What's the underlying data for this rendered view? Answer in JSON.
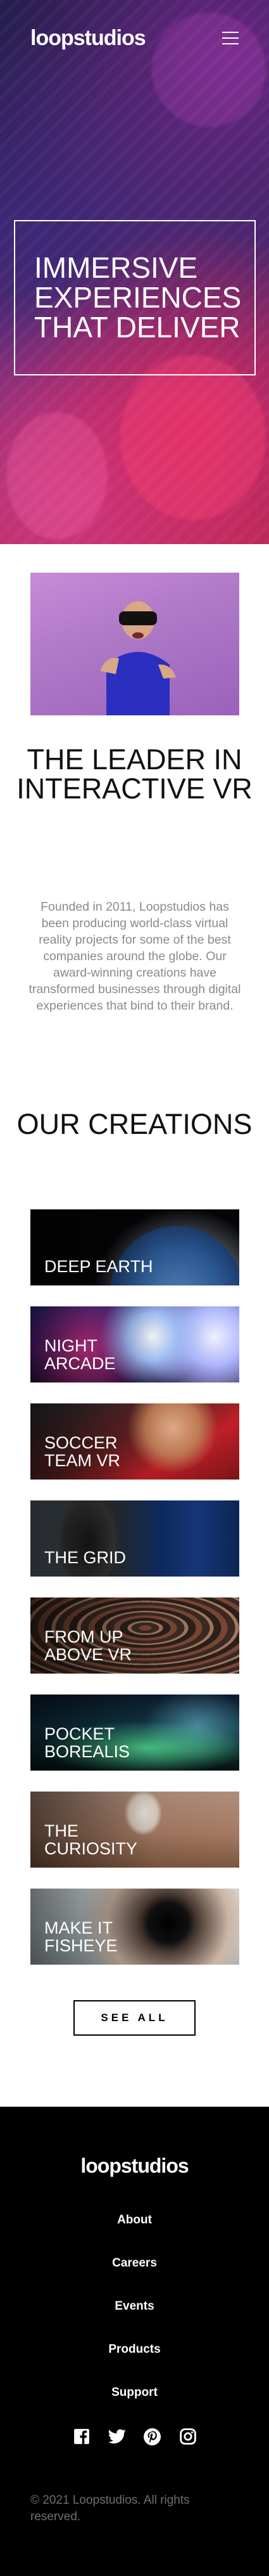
{
  "header": {
    "logo": "loopstudios",
    "menu_icon": "hamburger-menu-icon"
  },
  "hero": {
    "title": "Immersive experiences that deliver"
  },
  "leader": {
    "title": "The leader in interactive VR",
    "text": "Founded in 2011, Loopstudios has been producing world-class virtual reality projects for some of the best companies around the globe. Our award-winning creations have transformed businesses through digital experiences that bind to their brand."
  },
  "creations": {
    "title": "Our creations",
    "items": [
      {
        "label": "Deep Earth"
      },
      {
        "label": "Night Arcade"
      },
      {
        "label": "Soccer Team VR"
      },
      {
        "label": "The Grid"
      },
      {
        "label": "From Up Above VR"
      },
      {
        "label": "Pocket Borealis"
      },
      {
        "label": "The Curiosity"
      },
      {
        "label": "Make it Fisheye"
      }
    ],
    "see_all": "SEE ALL"
  },
  "footer": {
    "logo": "loopstudios",
    "nav": [
      "About",
      "Careers",
      "Events",
      "Products",
      "Support"
    ],
    "socials": [
      "facebook-icon",
      "twitter-icon",
      "pinterest-icon",
      "instagram-icon"
    ],
    "copyright": "© 2021 Loopstudios. All rights reserved."
  }
}
